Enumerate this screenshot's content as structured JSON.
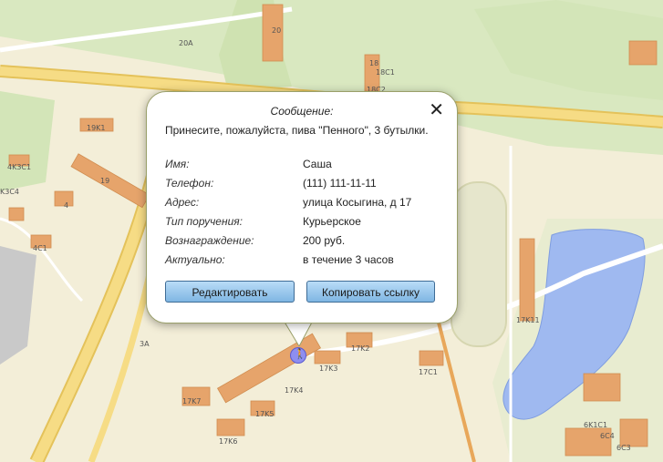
{
  "map": {
    "labels": [
      "20A",
      "20",
      "18",
      "18C1",
      "18C2",
      "19K1",
      "19",
      "4K3C1",
      "K3C4",
      "4",
      "4C1",
      "3A",
      "17K2",
      "17K3",
      "17K4",
      "17K5",
      "17K6",
      "17K7",
      "17C1",
      "17K11",
      "6K1C1",
      "6C4",
      "6C3"
    ],
    "marker_icon": "walking-person-icon"
  },
  "popup": {
    "title": "Сообщение:",
    "message": "Принесите, пожалуйста, пива \"Пенного\", 3 бутылки.",
    "close_icon": "close-icon",
    "fields": [
      {
        "label": "Имя:",
        "value": "Саша"
      },
      {
        "label": "Телефон:",
        "value": "(111) 111-11-11"
      },
      {
        "label": "Адрес:",
        "value": "улица Косыгина, д 17"
      },
      {
        "label": "Тип поручения:",
        "value": "Курьерское"
      },
      {
        "label": "Вознаграждение:",
        "value": "200 руб."
      },
      {
        "label": "Актуально:",
        "value": "в течение 3 часов"
      }
    ],
    "buttons": {
      "edit": "Редактировать",
      "copy_link": "Копировать ссылку"
    }
  }
}
